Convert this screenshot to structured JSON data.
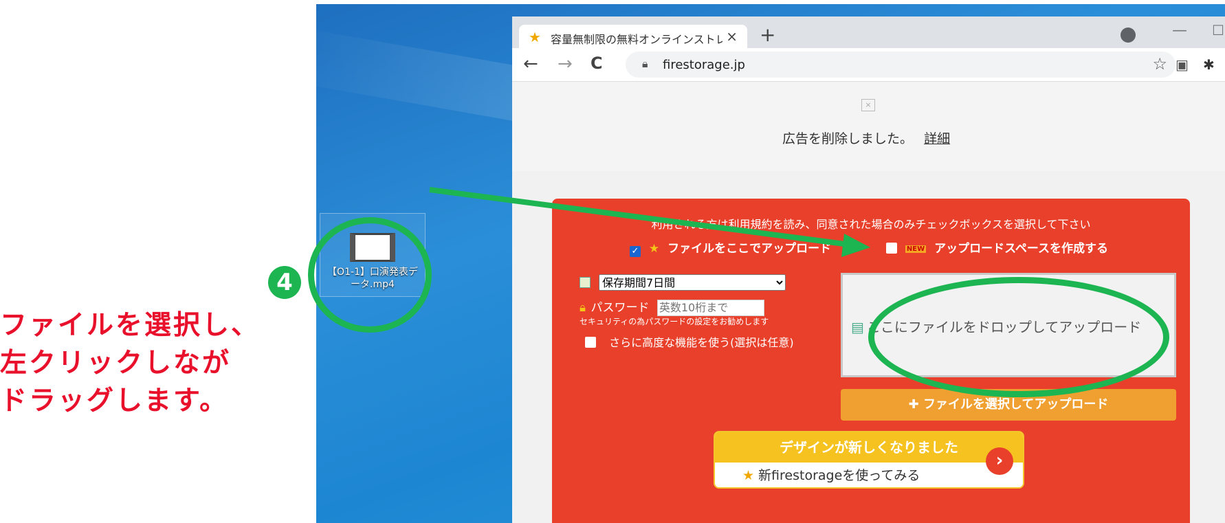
{
  "instruction": {
    "line1": "ファイルを選択し、",
    "line2": "左クリックしなが",
    "line3": "ドラッグします。"
  },
  "step_number": "4",
  "desktop": {
    "file_name_line1": "【O1-1】口演発表デ",
    "file_name_line2": "ータ.mp4"
  },
  "browser": {
    "tab_title": "容量無制限の無料オンラインストレージ",
    "tab_close": "×",
    "new_tab": "+",
    "back": "←",
    "forward": "→",
    "reload": "C",
    "url": "firestorage.jp",
    "minimize": "—",
    "maximize": "☐"
  },
  "page": {
    "ad_removed_text": "広告を削除しました。",
    "ad_details_link": "詳細",
    "terms_notice": "利用される方は利用規約を読み、同意された場合のみチェックボックスを選択して下さい",
    "upload_here_label": "ファイルをここでアップロード",
    "create_space_label": "アップロードスペースを作成する",
    "new_badge": "NEW",
    "retention_selected": "保存期間7日間",
    "password_label": "パスワード",
    "password_placeholder": "英数10桁まで",
    "password_note": "セキュリティの為パスワードの設定をお勧めします",
    "advanced_label": "さらに高度な機能を使う(選択は任意)",
    "drop_zone_text": "ここにファイルをドロップしてアップロード",
    "select_button_label": "ファイルを選択してアップロード",
    "promo_title": "デザインが新しくなりました",
    "promo_link": "新firestorageを使ってみる"
  },
  "colors": {
    "panel_red": "#e8402b",
    "highlight_green": "#1db552",
    "instruction_red": "#e8102a",
    "button_orange": "#f0a030"
  },
  "icons": [
    "film-icon",
    "star-favicon",
    "lock-icon",
    "star-bookmark-icon",
    "extension-icon",
    "calendar-icon",
    "padlock-icon",
    "file-drop-icon",
    "plus-icon",
    "chevron-right-icon"
  ]
}
